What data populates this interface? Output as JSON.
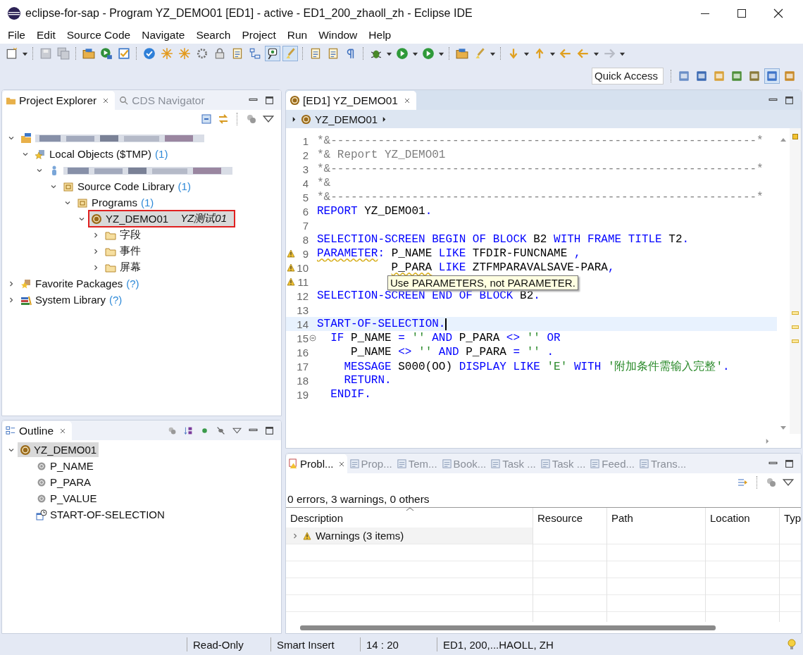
{
  "window": {
    "title": "eclipse-for-sap - Program YZ_DEMO01 [ED1] - active - ED1_200_zhaoll_zh - Eclipse IDE"
  },
  "menu": [
    "File",
    "Edit",
    "Source Code",
    "Navigate",
    "Search",
    "Project",
    "Run",
    "Window",
    "Help"
  ],
  "quick_access": {
    "placeholder": "Quick Access"
  },
  "project_explorer": {
    "tabs": [
      {
        "label": "Project Explorer",
        "selected": true
      },
      {
        "label": "CDS Navigator",
        "selected": false
      }
    ],
    "tree": [
      {
        "kind": "project",
        "expanded": true,
        "children": [
          {
            "kind": "package",
            "label": "Local Objects ($TMP)",
            "count": "(1)",
            "expanded": true,
            "children": [
              {
                "kind": "user",
                "expanded": true,
                "children": [
                  {
                    "kind": "gfolder",
                    "label": "Source Code Library",
                    "count": "(1)",
                    "expanded": true,
                    "children": [
                      {
                        "kind": "tfolder",
                        "label": "Programs",
                        "count": "(1)",
                        "expanded": true,
                        "children": [
                          {
                            "kind": "program",
                            "label": "YZ_DEMO01",
                            "note": "YZ测试01",
                            "expanded": true,
                            "selected": true,
                            "marked": true,
                            "children": [
                              {
                                "kind": "folder",
                                "label": "字段",
                                "expanded": false
                              },
                              {
                                "kind": "folder",
                                "label": "事件",
                                "expanded": false
                              },
                              {
                                "kind": "folder",
                                "label": "屏幕",
                                "expanded": false
                              }
                            ]
                          }
                        ]
                      }
                    ]
                  }
                ]
              }
            ]
          }
        ]
      },
      {
        "kind": "favorite",
        "label": "Favorite Packages",
        "count": "(?)",
        "expanded": false
      },
      {
        "kind": "library",
        "label": "System Library",
        "count": "(?)",
        "expanded": false
      }
    ]
  },
  "outline": {
    "title": "Outline",
    "root": {
      "label": "YZ_DEMO01",
      "selected": true,
      "expanded": true
    },
    "children": [
      {
        "kind": "field",
        "label": "P_NAME"
      },
      {
        "kind": "field",
        "label": "P_PARA"
      },
      {
        "kind": "field",
        "label": "P_VALUE"
      },
      {
        "kind": "event",
        "label": "START-OF-SELECTION"
      }
    ]
  },
  "editor": {
    "tab": {
      "label": "[ED1] YZ_DEMO01",
      "selected": true
    },
    "breadcrumb": "YZ_DEMO01",
    "lines": [
      {
        "n": "1",
        "segs": [
          {
            "t": "*&---------------------------------------------------------------*",
            "kind": "comment"
          }
        ]
      },
      {
        "n": "2",
        "segs": [
          {
            "t": "*& Report YZ_DEMO01",
            "kind": "comment"
          }
        ]
      },
      {
        "n": "3",
        "segs": [
          {
            "t": "*&---------------------------------------------------------------*",
            "kind": "comment"
          }
        ]
      },
      {
        "n": "4",
        "segs": [
          {
            "t": "*&",
            "kind": "comment"
          }
        ]
      },
      {
        "n": "5",
        "segs": [
          {
            "t": "*&---------------------------------------------------------------*",
            "kind": "comment"
          }
        ]
      },
      {
        "n": "6",
        "segs": [
          {
            "t": "REPORT",
            "kind": "kw"
          },
          {
            "t": " YZ_DEMO01",
            "kind": "id"
          },
          {
            "t": ".",
            "kind": "kw"
          }
        ]
      },
      {
        "n": "7"
      },
      {
        "n": "8",
        "segs": [
          {
            "t": "SELECTION-SCREEN BEGIN OF BLOCK",
            "kind": "kw"
          },
          {
            "t": " B2 ",
            "kind": "id"
          },
          {
            "t": "WITH FRAME TITLE",
            "kind": "kw"
          },
          {
            "t": " T2",
            "kind": "id"
          },
          {
            "t": ".",
            "kind": "kw"
          }
        ]
      },
      {
        "n": "9",
        "warning": true,
        "segs": [
          {
            "t": "PARAMETER",
            "kind": "kw",
            "underline": true
          },
          {
            "t": ":",
            "kind": "kw"
          },
          {
            "t": " P_NAME ",
            "kind": "id"
          },
          {
            "t": "LIKE",
            "kind": "kw"
          },
          {
            "t": " TFDIR-FUNCNAME ",
            "kind": "id"
          },
          {
            "t": ",",
            "kind": "kw"
          }
        ]
      },
      {
        "n": "10",
        "warning": true,
        "continued": true,
        "segs": [
          {
            "t": "P_PARA",
            "kind": "id",
            "underline": true
          },
          {
            "t": " LIKE",
            "kind": "kw"
          },
          {
            "t": " ZTFMPARAVALSAVE-PARA",
            "kind": "id"
          },
          {
            "t": ",",
            "kind": "kw"
          }
        ]
      },
      {
        "n": "11",
        "warning": true
      },
      {
        "n": "12",
        "segs": [
          {
            "t": "SELECTION-SCREEN END OF BLOCK",
            "kind": "kw"
          },
          {
            "t": " B2",
            "kind": "id"
          },
          {
            "t": ".",
            "kind": "kw"
          }
        ]
      },
      {
        "n": "13"
      },
      {
        "n": "14",
        "current": true,
        "segs": [
          {
            "t": "START-OF-SELECTION",
            "kind": "kw"
          },
          {
            "t": ".",
            "kind": "kw"
          }
        ]
      },
      {
        "n": "15",
        "fold": true,
        "segs": [
          {
            "t": "  IF",
            "kind": "kw"
          },
          {
            "t": " P_NAME ",
            "kind": "id"
          },
          {
            "t": "=",
            "kind": "kw"
          },
          {
            "t": " '' ",
            "kind": "str"
          },
          {
            "t": "AND",
            "kind": "kw"
          },
          {
            "t": " P_PARA ",
            "kind": "id"
          },
          {
            "t": "<>",
            "kind": "kw"
          },
          {
            "t": " '' ",
            "kind": "str"
          },
          {
            "t": "OR",
            "kind": "kw"
          }
        ]
      },
      {
        "n": "16",
        "segs": [
          {
            "t": "     P_NAME ",
            "kind": "id"
          },
          {
            "t": "<>",
            "kind": "kw"
          },
          {
            "t": " '' ",
            "kind": "str"
          },
          {
            "t": "AND",
            "kind": "kw"
          },
          {
            "t": " P_PARA ",
            "kind": "id"
          },
          {
            "t": "=",
            "kind": "kw"
          },
          {
            "t": " '' ",
            "kind": "str"
          },
          {
            "t": ".",
            "kind": "kw"
          }
        ]
      },
      {
        "n": "17",
        "segs": [
          {
            "t": "    MESSAGE",
            "kind": "kw"
          },
          {
            "t": " S000(OO) ",
            "kind": "id"
          },
          {
            "t": "DISPLAY LIKE",
            "kind": "kw"
          },
          {
            "t": " 'E' ",
            "kind": "str"
          },
          {
            "t": "WITH",
            "kind": "kw"
          },
          {
            "t": " '附加条件需输入完整'",
            "kind": "str"
          },
          {
            "t": ".",
            "kind": "kw"
          }
        ]
      },
      {
        "n": "18",
        "segs": [
          {
            "t": "    RETURN",
            "kind": "kw"
          },
          {
            "t": ".",
            "kind": "kw"
          }
        ]
      },
      {
        "n": "19",
        "segs": [
          {
            "t": "  ENDIF",
            "kind": "kw"
          },
          {
            "t": ".",
            "kind": "kw"
          }
        ]
      }
    ],
    "tooltip": "Use PARAMETERS, not PARAMETER."
  },
  "problems": {
    "tabs": [
      {
        "label": "Probl...",
        "selected": true
      },
      {
        "label": "Prop...",
        "selected": false
      },
      {
        "label": "Tem...",
        "selected": false
      },
      {
        "label": "Book...",
        "selected": false
      },
      {
        "label": "Task ...",
        "selected": false
      },
      {
        "label": "Task ...",
        "selected": false
      },
      {
        "label": "Feed...",
        "selected": false
      },
      {
        "label": "Trans...",
        "selected": false
      }
    ],
    "summary": "0 errors, 3 warnings, 0 others",
    "columns": [
      "Description",
      "Resource",
      "Path",
      "Location",
      "Typ"
    ],
    "rows": [
      {
        "label": "Warnings (3 items)",
        "expanded": false
      }
    ]
  },
  "status_bar": [
    "Read-Only",
    "Smart Insert",
    "14 : 20",
    "ED1, 200,...HAOLL, ZH"
  ]
}
